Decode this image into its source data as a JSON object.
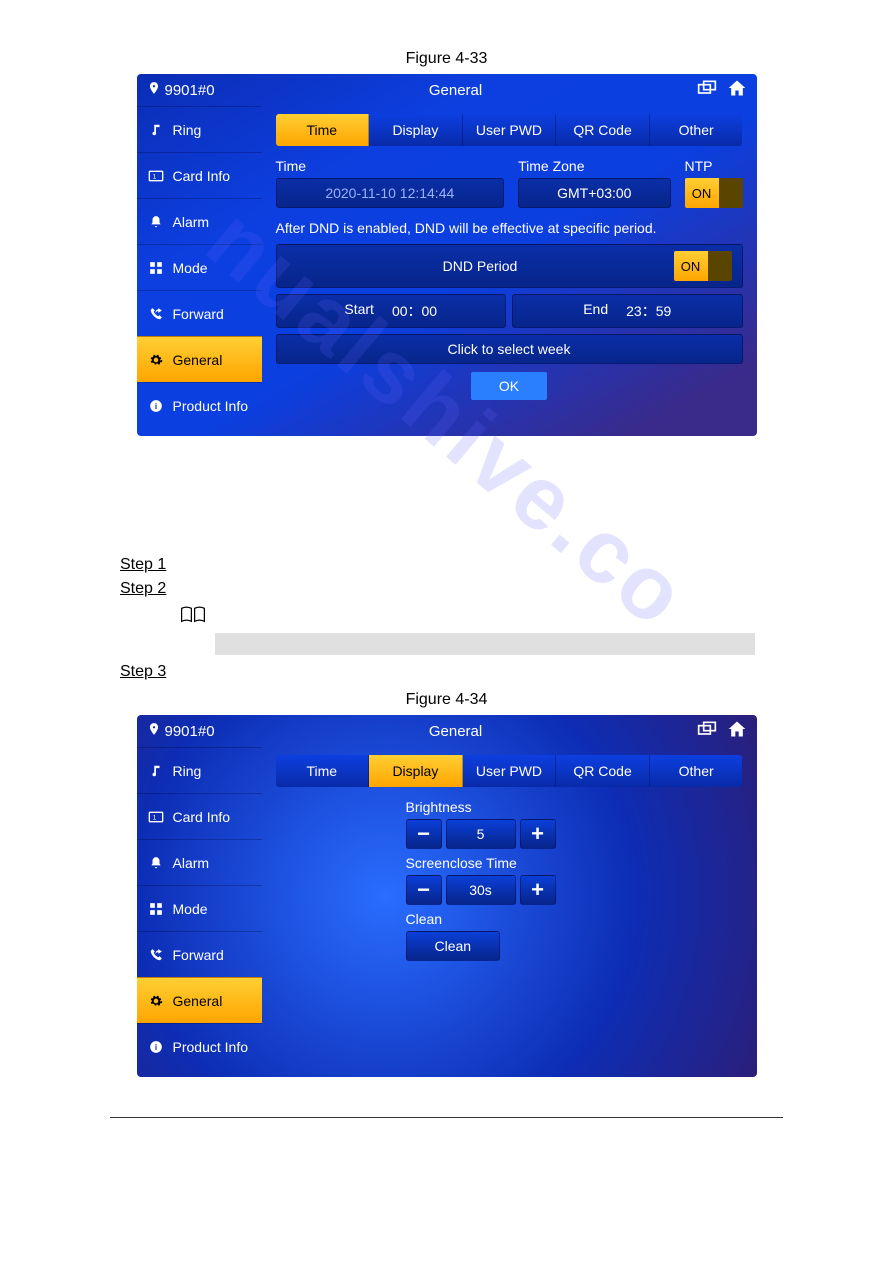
{
  "watermark": "nualshive.co",
  "figure1": {
    "caption": "Figure 4-33"
  },
  "figure2": {
    "caption": "Figure 4-34"
  },
  "topbar": {
    "location": "9901#0",
    "title": "General"
  },
  "sidebar": {
    "items": [
      {
        "label": "Ring"
      },
      {
        "label": "Card Info"
      },
      {
        "label": "Alarm"
      },
      {
        "label": "Mode"
      },
      {
        "label": "Forward"
      },
      {
        "label": "General"
      },
      {
        "label": "Product Info"
      }
    ]
  },
  "tabs": {
    "time": "Time",
    "display": "Display",
    "userpwd": "User PWD",
    "qrcode": "QR Code",
    "other": "Other"
  },
  "screen1": {
    "time_label": "Time",
    "time_value": "2020-11-10 12:14:44",
    "tz_label": "Time Zone",
    "tz_value": "GMT+03:00",
    "ntp_label": "NTP",
    "ntp_toggle": "ON",
    "dnd_note": "After DND is enabled, DND will be effective at specific period.",
    "dnd_period_label": "DND Period",
    "dnd_toggle": "ON",
    "start_label": "Start",
    "start_value": "00：00",
    "end_label": "End",
    "end_value": "23：59",
    "week_label": "Click to select week",
    "ok": "OK"
  },
  "screen2": {
    "brightness_label": "Brightness",
    "brightness_value": "5",
    "screenclose_label": "Screenclose Time",
    "screenclose_value": "30s",
    "clean_label": "Clean",
    "clean_button": "Clean"
  },
  "steps": {
    "s1": "Step 1",
    "s2": "Step 2",
    "s3": "Step 3"
  }
}
